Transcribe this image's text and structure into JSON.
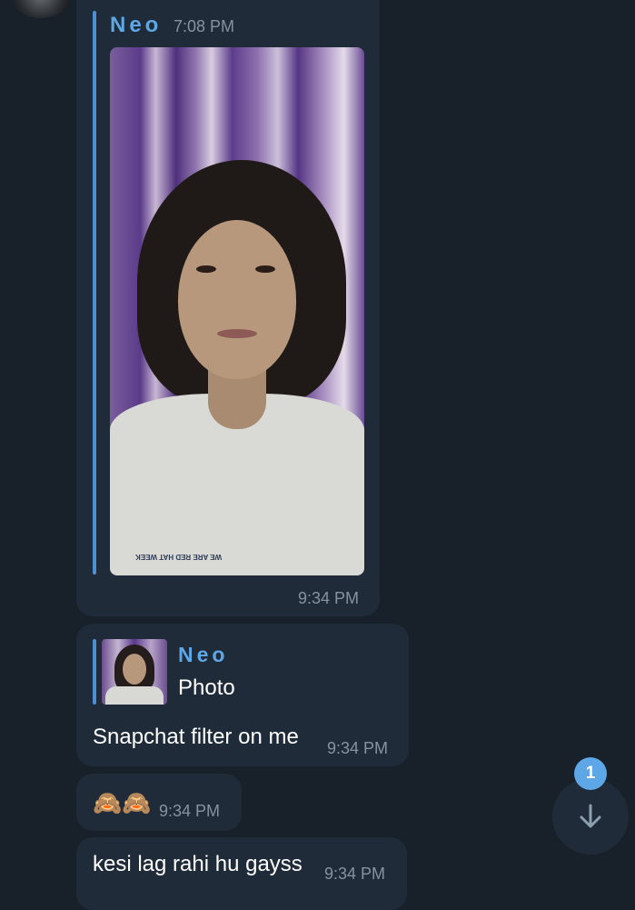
{
  "messages": {
    "photo_post": {
      "sender": "Neo",
      "forward_time": "7:08 PM",
      "time": "9:34 PM",
      "image_logo": "WE ARE RED HAT WEEK"
    },
    "reply_message": {
      "reply_sender": "Neo",
      "reply_preview": "Photo",
      "text": "Snapchat filter on me",
      "time": "9:34 PM"
    },
    "emoji_message": {
      "text": "🙈🙈",
      "time": "9:34 PM"
    },
    "last_message": {
      "text": "kesi lag rahi hu gayss",
      "time": "9:34 PM"
    }
  },
  "scroll_button": {
    "icon": "arrow-down-icon",
    "unread_count": "1"
  },
  "colors": {
    "background": "#182029",
    "bubble": "#1f2b38",
    "accent": "#5ea7e6"
  }
}
